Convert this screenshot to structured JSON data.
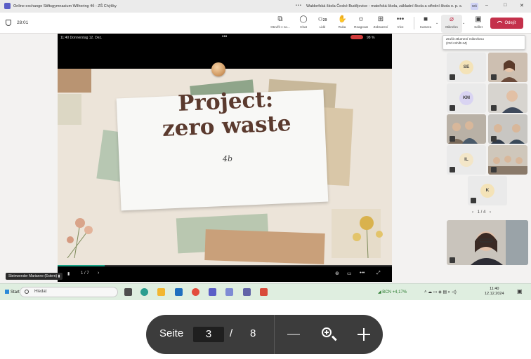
{
  "window": {
    "title": "Online exchange Stiftsgymnasium Wilhering 4б - ZŠ Chýšky",
    "dots": "•••",
    "organization": "Waldorfská škola České Budějovice - mateřská škola, základní škola a střední škola o. p. s.",
    "org_badge": "WŠ"
  },
  "toolbar": {
    "timer": "28:01",
    "open": "Otevřít v no...",
    "chat": "Chat",
    "people": "Lidé",
    "people_count": "29",
    "hand": "Ruka",
    "react": "Reagovat",
    "view": "Zobrazení",
    "more": "Více",
    "camera": "Kamera",
    "mic": "Mikrofon",
    "share": "Sdílet",
    "leave": "Odejít"
  },
  "tooltip": {
    "line1": "Zrušit ztlumení mikrofonu",
    "line2": "(Ctrl+Shift+M)"
  },
  "stage": {
    "phone_time": "11:40  Donnerstag 12. Dez.",
    "phone_dots": "•••",
    "battery": "98 %",
    "slide_title_line1": "Project:",
    "slide_title_line2": "zero waste",
    "slide_subtitle": "4b",
    "page_counter": "1 / 7",
    "progress": 0.14,
    "presenter": "Steinwender Marianne (Extern)"
  },
  "participants": [
    {
      "initials": "SE",
      "color": "#f4e3b8"
    },
    {
      "initials": "KM",
      "color": "#d9d4f2"
    },
    {
      "initials": "IL",
      "color": "#f3e6c8"
    },
    {
      "initials": "K",
      "color": "#f4e3b8"
    }
  ],
  "participants_pager": "1 / 4",
  "taskbar": {
    "start": "Start",
    "search": "Hledat",
    "market": "BCN",
    "market_change": "+4,17%",
    "time": "11:40",
    "date": "12.12.2024"
  },
  "pdf_viewer": {
    "page_label": "Seite",
    "current_page": "3",
    "separator": "/",
    "total_pages": "8"
  }
}
